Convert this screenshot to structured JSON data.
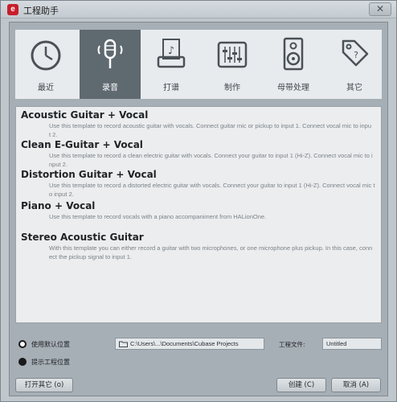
{
  "window": {
    "title": "工程助手",
    "app_icon": "cubase-logo-icon",
    "close_label": "✕"
  },
  "tabs": [
    {
      "label": "最近",
      "icon": "clock-icon",
      "active": false
    },
    {
      "label": "录音",
      "icon": "microphone-icon",
      "active": true
    },
    {
      "label": "打谱",
      "icon": "score-icon",
      "active": false
    },
    {
      "label": "制作",
      "icon": "mixer-icon",
      "active": false
    },
    {
      "label": "母带处理",
      "icon": "speaker-icon",
      "active": false
    },
    {
      "label": "其它",
      "icon": "tag-icon",
      "active": false
    }
  ],
  "templates": [
    {
      "title": "Acoustic Guitar + Vocal",
      "desc1": "Use this template to record acoustic guitar with vocals. Connect guitar mic or pickup to input  1. Connect vocal mic to inpu",
      "desc2": "t 2."
    },
    {
      "title": "Clean E-Guitar + Vocal",
      "desc1": "Use this template to record a clean electric guitar with vocals. Connect your guitar to input  1 (Hi-Z). Connect vocal mic to i",
      "desc2": "nput 2."
    },
    {
      "title": "Distortion Guitar + Vocal",
      "desc1": "Use this template to record a distorted electric guitar with vocals. Connect your guitar to input  1 (Hi-Z). Connect vocal mic t",
      "desc2": "o input 2."
    },
    {
      "title": "Piano + Vocal",
      "desc1": "Use this template to record vocals with a piano accompaniment from HALionOne.",
      "desc2": ""
    },
    {
      "title": "Stereo Acoustic Guitar",
      "desc1": "With this template you can either record a guitar with two microphones, or one microphone plus pickup. In this case, conn",
      "desc2": "ect the pickup signal to input 1."
    }
  ],
  "location": {
    "default_label": "使用默认位置",
    "prompt_label": "提示工程位置",
    "path": "C:\\Users\\...\\Documents\\Cubase Projects",
    "project_file_label": "工程文件:",
    "project_name": "Untitled"
  },
  "buttons": {
    "open_other": "打开其它 (o)",
    "create": "创建 (C)",
    "cancel": "取消 (A)"
  }
}
